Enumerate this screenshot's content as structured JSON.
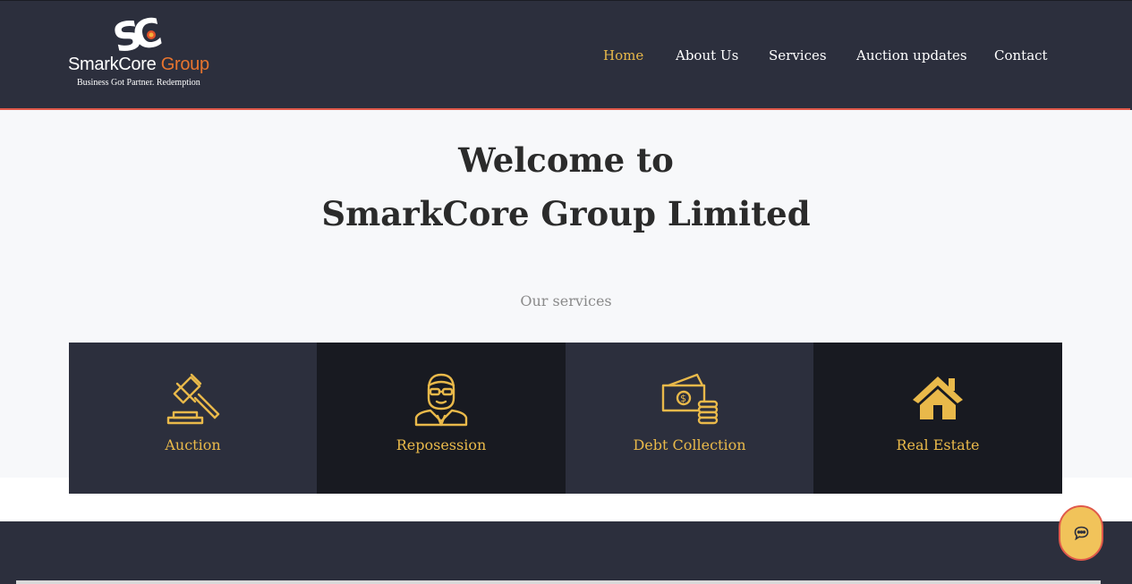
{
  "brand": {
    "name_part1": "SmarkCore",
    "name_part2": "Group",
    "tagline": "Business Got Partner. Redemption",
    "colors": {
      "primary": "#2c2f3d",
      "accent": "#e9b94a",
      "border": "#e0594a"
    }
  },
  "nav": {
    "items": [
      {
        "label": "Home",
        "active": true
      },
      {
        "label": "About Us",
        "active": false
      },
      {
        "label": "Services",
        "active": false
      },
      {
        "label": "Auction updates",
        "active": false
      },
      {
        "label": "Contact",
        "active": false
      }
    ]
  },
  "hero": {
    "title_line1": "Welcome to",
    "title_line2": "SmarkCore Group Limited",
    "services_label": "Our services"
  },
  "services": [
    {
      "label": "Auction",
      "icon": "gavel-icon"
    },
    {
      "label": "Reposession",
      "icon": "repo-agent-icon"
    },
    {
      "label": "Debt Collection",
      "icon": "money-coins-icon"
    },
    {
      "label": "Real Estate",
      "icon": "house-icon"
    }
  ],
  "chat": {
    "icon": "chat-icon"
  }
}
